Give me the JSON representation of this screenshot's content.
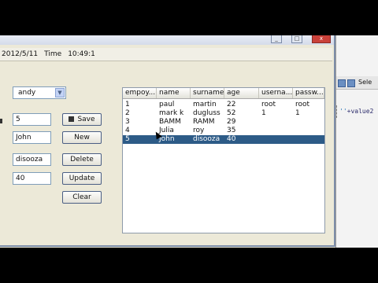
{
  "statusbar": {
    "date": "2012/5/11",
    "time_label": "Time",
    "time": "10:49:1"
  },
  "combo": {
    "selected": "andy"
  },
  "fields": {
    "id": "5",
    "name": "John",
    "surname": "disooza",
    "age": "40"
  },
  "buttons": {
    "save": "Save",
    "new": "New",
    "delete": "Delete",
    "update": "Update",
    "clear": "Clear"
  },
  "table": {
    "columns": [
      "empoy...",
      "name",
      "surname",
      "age",
      "userna...",
      "passw..."
    ],
    "rows": [
      [
        "1",
        "paul",
        "martin",
        "22",
        "root",
        "root"
      ],
      [
        "2",
        "mark k",
        "dugluss",
        "52",
        "1",
        "1"
      ],
      [
        "3",
        "BAMM",
        "RAMM",
        "29",
        "",
        ""
      ],
      [
        "4",
        "Julia",
        "roy",
        "35",
        "",
        ""
      ],
      [
        "5",
        "John",
        "disooza",
        "40",
        "",
        ""
      ]
    ],
    "selected_index": 4
  },
  "ide": {
    "toolbar_label": "Sele",
    "code_str": "''",
    "code_rest": "+value2"
  }
}
